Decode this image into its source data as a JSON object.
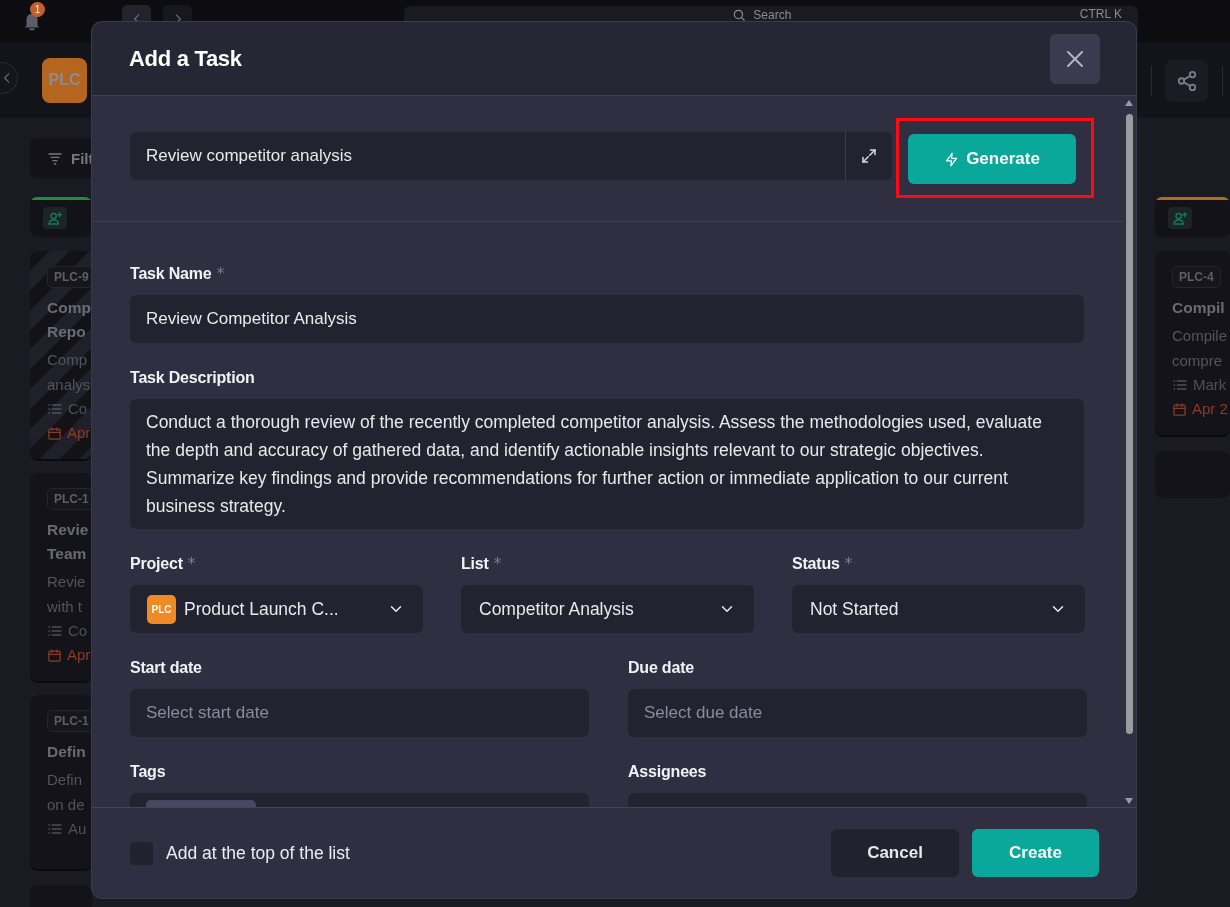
{
  "topbar": {
    "notification_count": "1",
    "search_label": "Search",
    "search_shortcut": "CTRL K"
  },
  "project_badge": "PLC",
  "filter_button": "Filt",
  "left_column": {
    "color": "#1e8f3c",
    "cards": [
      {
        "key": "PLC-9",
        "striped": true,
        "title": [
          "Comp",
          "Repo"
        ],
        "description": [
          "Comp",
          "analys"
        ],
        "list": "Co",
        "date": "Apr"
      },
      {
        "key": "PLC-1",
        "striped": false,
        "title": [
          "Revie",
          "Team"
        ],
        "description": [
          "Revie",
          "with t"
        ],
        "list": "Co",
        "date": "Apr"
      },
      {
        "key": "PLC-1",
        "striped": false,
        "title": [
          "Defin"
        ],
        "description": [
          "Defin",
          "on de"
        ],
        "list": "Au"
      }
    ]
  },
  "right_column": {
    "color": "#b06d1e",
    "cards": [
      {
        "key": "PLC-4",
        "striped": false,
        "title": [
          "Compil"
        ],
        "description": [
          "Compile",
          "compre"
        ],
        "list": "Mark",
        "date": "Apr 2"
      }
    ]
  },
  "dialog": {
    "title": "Add a Task",
    "prompt": {
      "value": "Review competitor analysis"
    },
    "generate_button": "Generate",
    "task_name": {
      "label": "Task Name",
      "required": true,
      "value": "Review Competitor Analysis"
    },
    "task_description": {
      "label": "Task Description",
      "required": false,
      "value": "Conduct a thorough review of the recently completed competitor analysis. Assess the methodologies used, evaluate the depth and accuracy of gathered data, and identify actionable insights relevant to our strategic objectives. Summarize key findings and provide recommendations for further action or immediate application to our current business strategy."
    },
    "selects": [
      {
        "label": "Project",
        "required": true,
        "badge": "PLC",
        "value": "Product Launch C..."
      },
      {
        "label": "List",
        "required": true,
        "value": "Competitor Analysis"
      },
      {
        "label": "Status",
        "required": true,
        "value": "Not Started"
      }
    ],
    "dates": [
      {
        "label": "Start date",
        "required": false,
        "placeholder": "Select start date"
      },
      {
        "label": "Due date",
        "required": false,
        "placeholder": "Select due date"
      }
    ],
    "tags": {
      "label": "Tags",
      "required": false
    },
    "assignees": {
      "label": "Assignees",
      "required": false
    },
    "add_to_top": {
      "label": "Add at the top of the list",
      "checked": false
    },
    "cancel_button": "Cancel",
    "create_button": "Create"
  }
}
